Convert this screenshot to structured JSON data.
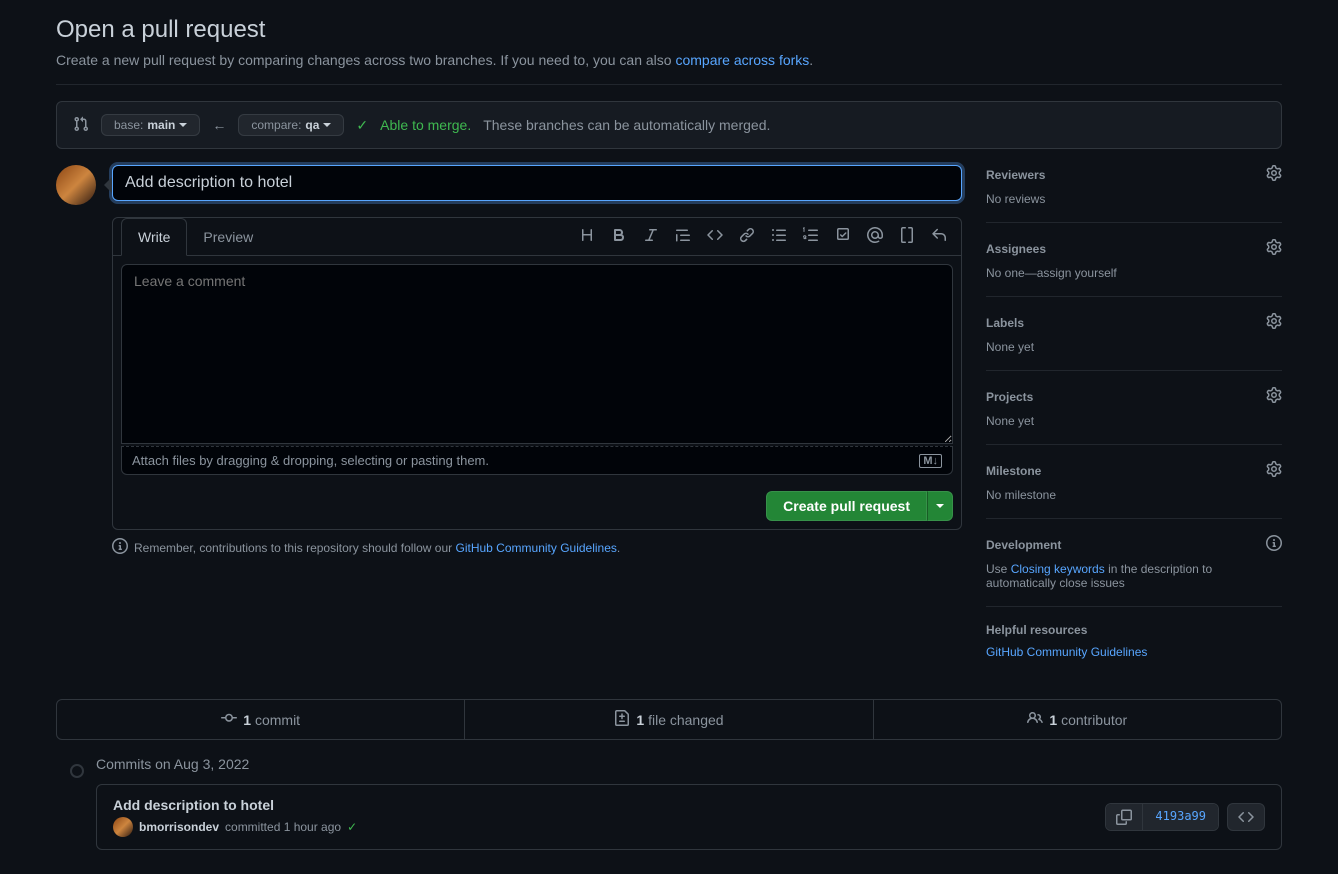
{
  "header": {
    "title": "Open a pull request",
    "subtitle_prefix": "Create a new pull request by comparing changes across two branches. If you need to, you can also ",
    "subtitle_link": "compare across forks",
    "subtitle_suffix": "."
  },
  "compare": {
    "base_label": "base: ",
    "base_branch": "main",
    "compare_label": "compare: ",
    "compare_branch": "qa",
    "merge_check": "✓",
    "merge_status": "Able to merge.",
    "merge_message": "These branches can be automatically merged."
  },
  "form": {
    "title_value": "Add description to hotel",
    "write_tab": "Write",
    "preview_tab": "Preview",
    "comment_placeholder": "Leave a comment",
    "attach_text": "Attach files by dragging & dropping, selecting or pasting them.",
    "markdown_badge": "M↓",
    "create_button": "Create pull request",
    "guidelines_prefix": "Remember, contributions to this repository should follow our ",
    "guidelines_link": "GitHub Community Guidelines",
    "guidelines_suffix": "."
  },
  "sidebar": {
    "reviewers": {
      "title": "Reviewers",
      "body": "No reviews"
    },
    "assignees": {
      "title": "Assignees",
      "body_prefix": "No one—",
      "body_link": "assign yourself"
    },
    "labels": {
      "title": "Labels",
      "body": "None yet"
    },
    "projects": {
      "title": "Projects",
      "body": "None yet"
    },
    "milestone": {
      "title": "Milestone",
      "body": "No milestone"
    },
    "development": {
      "title": "Development",
      "body_prefix": "Use ",
      "body_link": "Closing keywords",
      "body_suffix": " in the description to automatically close issues"
    },
    "resources": {
      "title": "Helpful resources",
      "body_link": "GitHub Community Guidelines"
    }
  },
  "stats": {
    "commits_count": "1",
    "commits_label": " commit",
    "files_count": "1",
    "files_label": " file changed",
    "contributors_count": "1",
    "contributors_label": " contributor"
  },
  "commits": {
    "date_header": "Commits on Aug 3, 2022",
    "items": [
      {
        "title": "Add description to hotel",
        "author": "bmorrisondev",
        "meta": " committed 1 hour ago",
        "sha": "4193a99"
      }
    ]
  }
}
